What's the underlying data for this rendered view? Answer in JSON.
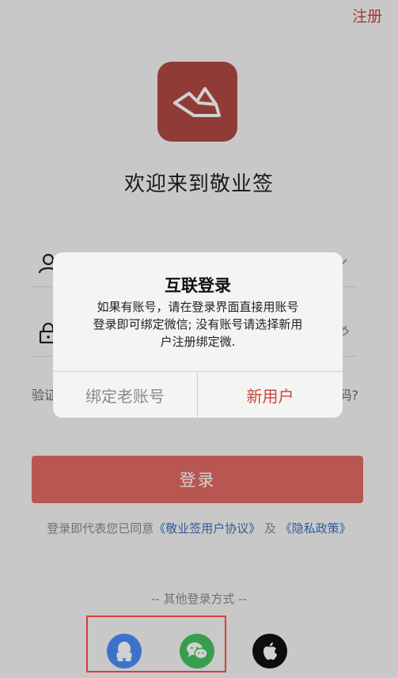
{
  "header": {
    "register_label": "注册"
  },
  "welcome": {
    "title": "欢迎来到敬业签"
  },
  "form": {
    "left_link": "验证",
    "right_link": "码?"
  },
  "login": {
    "button_label": "登录"
  },
  "agreement": {
    "prefix": "登录即代表您已同意",
    "user_agreement": "《敬业签用户协议》",
    "and": "及",
    "privacy_policy": "《隐私政策》"
  },
  "other_login": {
    "label": "-- 其他登录方式 --"
  },
  "social": {
    "items": [
      "qq-icon",
      "wechat-icon",
      "apple-icon"
    ]
  },
  "dialog": {
    "title": "互联登录",
    "message_line1": "如果有账号，请在登录界面直接用账号",
    "message_line2": "登录即可绑定微信; 没有账号请选择新用",
    "message_line3": "户注册绑定微.",
    "bind_old_label": "绑定老账号",
    "new_user_label": "新用户"
  },
  "colors": {
    "accent": "#c9463d",
    "logo_bg": "#b14842",
    "button_bg": "#e16b63",
    "link_blue": "#3d6fbf",
    "qq_blue": "#4c8cf7",
    "wechat_green": "#45c160"
  }
}
